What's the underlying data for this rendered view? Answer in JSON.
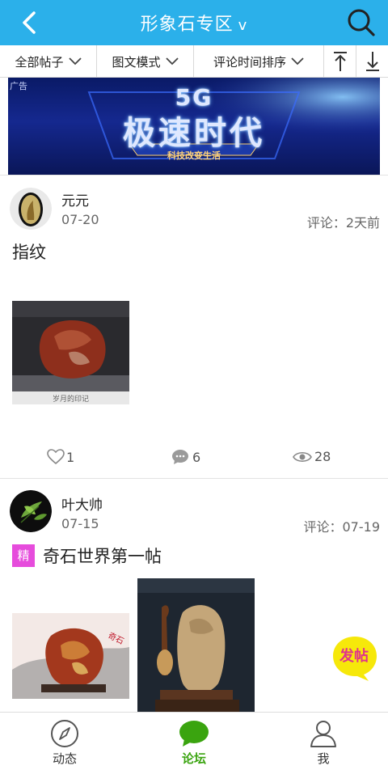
{
  "header": {
    "title": "形象石专区",
    "title_suffix": "v",
    "back_icon": "chevron-left-icon",
    "search_icon": "search-icon"
  },
  "filters": {
    "all_posts": "全部帖子",
    "view_mode": "图文模式",
    "sort": "评论时间排序",
    "to_top_icon": "arrow-up-to-top-icon",
    "download_icon": "arrow-down-download-icon"
  },
  "banner": {
    "ad_label": "广告",
    "line1": "5G",
    "line2": "极速时代",
    "line3": "科技改变生活"
  },
  "posts": [
    {
      "author": "元元",
      "date": "07-20",
      "comment_info": "评论：2天前",
      "title": "指纹",
      "image_caption": "岁月的印记",
      "likes": "1",
      "comments": "6",
      "views": "28"
    },
    {
      "author": "叶大帅",
      "date": "07-15",
      "comment_info": "评论：07-19",
      "badge": "精",
      "title": "奇石世界第一帖"
    }
  ],
  "fab": {
    "label": "发帖"
  },
  "bottom_nav": [
    {
      "label": "动态",
      "icon": "compass-icon"
    },
    {
      "label": "论坛",
      "icon": "chat-bubble-icon",
      "active": true
    },
    {
      "label": "我",
      "icon": "user-icon"
    }
  ],
  "colors": {
    "header_bg": "#2bb0ea",
    "active_tab": "#3aa40f",
    "badge": "#e64cdc",
    "fab_bg": "#f6e80a",
    "fab_text": "#e0338c"
  }
}
